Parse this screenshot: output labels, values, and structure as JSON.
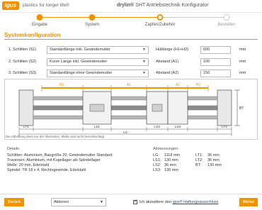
{
  "header": {
    "logo_text": "igus",
    "tagline": "plastics for longer life®",
    "title_brand": "drylin®",
    "title_rest": "SHT Antriebstechnik Konfigurator"
  },
  "stepper": {
    "steps": [
      {
        "label": "Eingabe",
        "state": "done"
      },
      {
        "label": "System",
        "state": "done"
      },
      {
        "label": "Zapfen/Zubehör",
        "state": "active"
      },
      {
        "label": "Bestellen",
        "state": "todo"
      }
    ],
    "colors": {
      "done": "#f39200",
      "active": "#f39200",
      "todo": "#c8c8c8"
    }
  },
  "section_title": "Systemkonfiguration",
  "config_rows": [
    {
      "label": "1. Schlitten (S1)",
      "select": "Standardlänge inkl. Gewindemutter",
      "param_label": "Hublänge (H1+H2)",
      "param_value": "500",
      "unit": "mm"
    },
    {
      "label": "2. Schlitten (S2)",
      "select": "Kurze Länge inkl. Gewindemutter",
      "param_label": "Abstand (A1)",
      "param_value": "100",
      "unit": "mm"
    },
    {
      "label": "3. Schlitten (S3)",
      "select": "Standardlänge ohne Gewindemutter",
      "param_label": "Abstand (A2)",
      "param_value": "150",
      "unit": "mm"
    }
  ],
  "drawing": {
    "labels": {
      "h1": "H1",
      "a1": "A1",
      "a2": "A2",
      "h2": "H2",
      "bt": "BT",
      "lt1": "LT1",
      "ls1": "LS1",
      "ls2": "LS2",
      "ls3": "LS3",
      "lt2": "LT2",
      "lg": "LG"
    },
    "caption": "Die Abbildung dient nur der Illustration, Maße sind nicht berücksichtigt",
    "colors": {
      "accent": "#f39200",
      "rail": "#9a9a9a",
      "block": "#e8e8e8",
      "line": "#333333"
    }
  },
  "details": {
    "title": "Details:",
    "lines": [
      "Schlitten: Aluminium, Baugröße 20, Gewindemutter Standard",
      "Traversen: Aluminium, mit Kugellager als Spindellager",
      "Welle: 20 mm, Edelstahl",
      "Spindel: TR 18 x 4, Rechtsgewinde, Edelstahl"
    ]
  },
  "dimensions": {
    "title": "Abmessungen:",
    "left": [
      {
        "name": "LG:",
        "value": "1118 mm"
      },
      {
        "name": "LS1:",
        "value": "130 mm"
      },
      {
        "name": "LS2:",
        "value": "36 mm"
      },
      {
        "name": "LS3:",
        "value": "130 mm"
      }
    ],
    "right": [
      {
        "name": "LT1:",
        "value": "36 mm"
      },
      {
        "name": "LT2:",
        "value": "36 mm"
      },
      {
        "name": "BT:",
        "value": "130 mm"
      }
    ]
  },
  "footer": {
    "back_label": "Zurück",
    "language_value": "Aktionen",
    "accept_prefix": "Ich akzeptiere den",
    "accept_link": "igus® Haftungsausschluss",
    "next_label": "Weiter",
    "accepted": true
  }
}
